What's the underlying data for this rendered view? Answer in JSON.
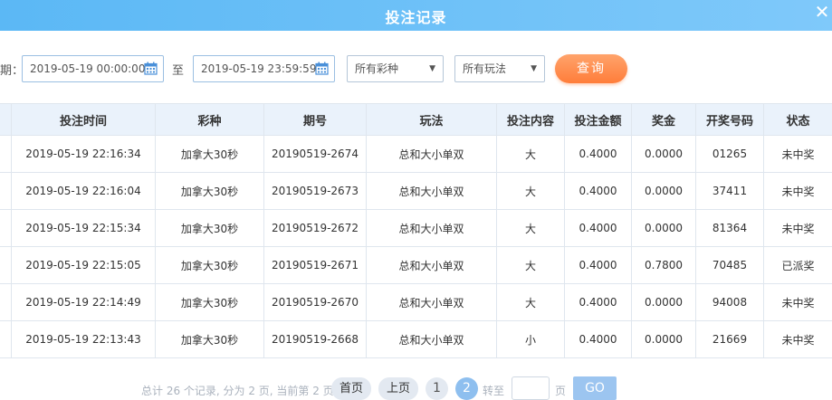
{
  "header": {
    "title": "投注记录",
    "close_label": "✕"
  },
  "filters": {
    "date_label_fragment": "期：",
    "start_date": "2019-05-19 00:00:00",
    "separator": "至",
    "end_date": "2019-05-19 23:59:59",
    "lottery_select": "所有彩种",
    "play_select": "所有玩法",
    "query_button": "查询"
  },
  "table": {
    "columns": [
      "投注时间",
      "彩种",
      "期号",
      "玩法",
      "投注内容",
      "投注金额",
      "奖金",
      "开奖号码",
      "状态"
    ],
    "rows": [
      {
        "time": "2019-05-19 22:16:34",
        "lottery": "加拿大30秒",
        "issue": "20190519-2674",
        "play": "总和大小单双",
        "content": "大",
        "amount": "0.4000",
        "bonus": "0.0000",
        "draw": "01265",
        "status": "未中奖",
        "status_type": "loss"
      },
      {
        "time": "2019-05-19 22:16:04",
        "lottery": "加拿大30秒",
        "issue": "20190519-2673",
        "play": "总和大小单双",
        "content": "大",
        "amount": "0.4000",
        "bonus": "0.0000",
        "draw": "37411",
        "status": "未中奖",
        "status_type": "loss"
      },
      {
        "time": "2019-05-19 22:15:34",
        "lottery": "加拿大30秒",
        "issue": "20190519-2672",
        "play": "总和大小单双",
        "content": "大",
        "amount": "0.4000",
        "bonus": "0.0000",
        "draw": "81364",
        "status": "未中奖",
        "status_type": "loss"
      },
      {
        "time": "2019-05-19 22:15:05",
        "lottery": "加拿大30秒",
        "issue": "20190519-2671",
        "play": "总和大小单双",
        "content": "大",
        "amount": "0.4000",
        "bonus": "0.7800",
        "draw": "70485",
        "status": "已派奖",
        "status_type": "paid"
      },
      {
        "time": "2019-05-19 22:14:49",
        "lottery": "加拿大30秒",
        "issue": "20190519-2670",
        "play": "总和大小单双",
        "content": "大",
        "amount": "0.4000",
        "bonus": "0.0000",
        "draw": "94008",
        "status": "未中奖",
        "status_type": "loss"
      },
      {
        "time": "2019-05-19 22:13:43",
        "lottery": "加拿大30秒",
        "issue": "20190519-2668",
        "play": "总和大小单双",
        "content": "小",
        "amount": "0.4000",
        "bonus": "0.0000",
        "draw": "21669",
        "status": "未中奖",
        "status_type": "loss"
      }
    ]
  },
  "pagination": {
    "summary": "总计 26 个记录, 分为 2 页, 当前第 2 页",
    "first": "首页",
    "prev": "上页",
    "pages": [
      "1",
      "2"
    ],
    "current_page": "2",
    "goto_label": "转至",
    "page_unit": "页",
    "go_button": "GO"
  },
  "colors": {
    "header": "#6ec0f8",
    "accent_orange": "#ff8a45",
    "paid_status": "#f08a2c",
    "loss_status": "#999999"
  },
  "icons": {
    "calendar": "calendar-icon",
    "close": "close-icon",
    "dropdown": "caret-down-icon"
  }
}
